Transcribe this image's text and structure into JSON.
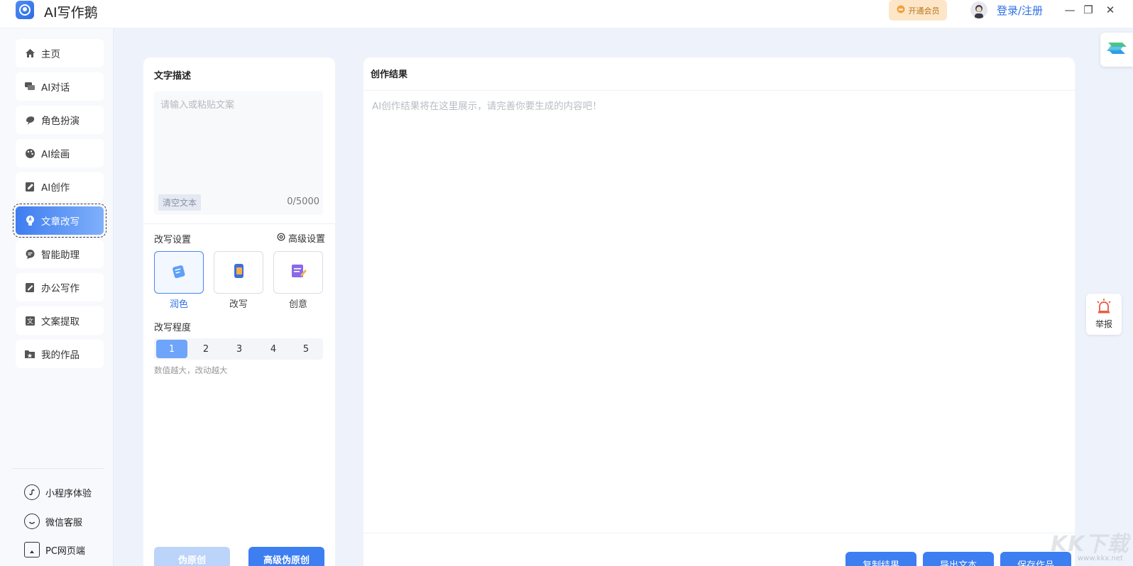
{
  "titlebar": {
    "app_title": "AI写作鹅",
    "vip_label": "开通会员",
    "login_label": "登录/注册",
    "minimize": "—",
    "restore": "❐",
    "close": "✕"
  },
  "sidebar": {
    "items": [
      {
        "label": "主页",
        "icon": "home-icon"
      },
      {
        "label": "AI对话",
        "icon": "chat-icon"
      },
      {
        "label": "角色扮演",
        "icon": "roleplay-icon"
      },
      {
        "label": "AI绘画",
        "icon": "palette-icon"
      },
      {
        "label": "AI创作",
        "icon": "edit-icon"
      },
      {
        "label": "文章改写",
        "icon": "bulb-icon",
        "active": true
      },
      {
        "label": "智能助理",
        "icon": "assistant-icon"
      },
      {
        "label": "办公写作",
        "icon": "document-icon"
      },
      {
        "label": "文案提取",
        "icon": "extract-icon"
      },
      {
        "label": "我的作品",
        "icon": "folder-icon"
      }
    ],
    "bottom_links": [
      {
        "label": "小程序体验",
        "icon": "miniprogram-icon"
      },
      {
        "label": "微信客服",
        "icon": "service-icon"
      },
      {
        "label": "PC网页端",
        "icon": "monitor-icon"
      }
    ]
  },
  "left_panel": {
    "desc_title": "文字描述",
    "input_placeholder": "请输入或粘贴文案",
    "clear_label": "清空文本",
    "char_count": "0/5000",
    "settings_title": "改写设置",
    "advanced_label": "高级设置",
    "modes": [
      {
        "label": "润色",
        "active": true
      },
      {
        "label": "改写",
        "active": false
      },
      {
        "label": "创意",
        "active": false
      }
    ],
    "level_title": "改写程度",
    "levels": [
      "1",
      "2",
      "3",
      "4",
      "5"
    ],
    "active_level": "1",
    "hint": "数值越大，改动越大",
    "btn_pseudo": "伪原创",
    "btn_advanced": "高级伪原创"
  },
  "right_panel": {
    "title": "创作结果",
    "placeholder": "AI创作结果将在这里展示，请完善你要生成的内容吧！",
    "actions": [
      "复制结果",
      "导出文本",
      "保存作品"
    ]
  },
  "widgets": {
    "report_label": "举报",
    "watermark": "KK下载",
    "watermark_url": "www.kkx.net"
  },
  "colors": {
    "accent": "#3d7ef1",
    "active_nav_start": "#3f7df0",
    "active_nav_end": "#7fb0fb",
    "background": "#eef3fb"
  }
}
